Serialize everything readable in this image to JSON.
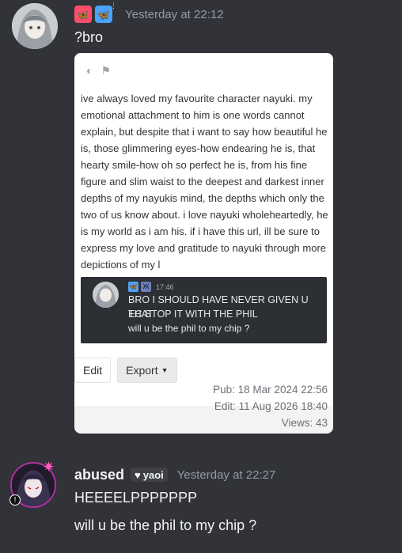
{
  "message1": {
    "avatar_alt": "avatar",
    "role_icons": [
      "butterfly-red-icon",
      "butterfly-blue-icon"
    ],
    "timestamp": "Yesterday at 22:12",
    "text": "?bro",
    "embed": {
      "icons": [
        "half-circle-icon",
        "flag-icon"
      ],
      "body": "ive always loved my favourite character nayuki. my emotional attachment to him is one words cannot explain, but despite that i want to say how beautiful he is, those glimmering eyes-how endearing he is, that hearty smile-how oh so perfect he is, from his fine figure and slim waist to the deepest and darkest inner depths of my nayukis mind, the depths which only the two of us know about. i love nayuki wholeheartedly, he is my world as i am his. if i have this url, ill be sure to express my love and gratitude to nayuki through more depictions of my l",
      "quote": {
        "time": "17:46",
        "line1": "BRO I SHOULD HAVE NEVER GIVEN U THAT",
        "line2": "EC STOP IT WITH THE PHIL",
        "line3": "will u be the phil to my chip ?"
      },
      "buttons": {
        "edit": "Edit",
        "export": "Export"
      },
      "pub": "Pub: 18 Mar 2024 22:56",
      "edit_date": "Edit: 11 Aug 2026 18:40",
      "views": "Views: 43"
    }
  },
  "message2": {
    "username": "abused",
    "tag": "yaoi",
    "timestamp": "Yesterday at 22:27",
    "line1": "HEEEELPPPPPPP",
    "line2": "will u be the phil to my chip ?"
  },
  "colors": {
    "background": "#313338",
    "embed_bg": "#ffffff",
    "quote_bg": "#2c2f33",
    "role_red": "#ff4d6a",
    "role_blue": "#4aa3ff"
  }
}
